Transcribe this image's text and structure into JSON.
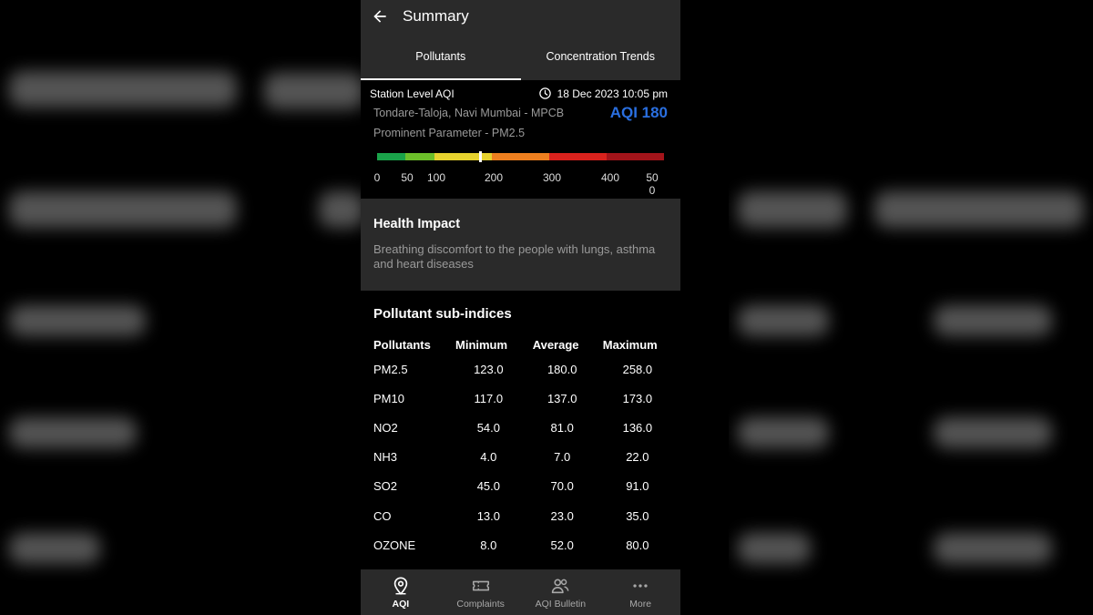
{
  "header": {
    "title": "Summary"
  },
  "tabs": [
    {
      "label": "Pollutants",
      "active": true
    },
    {
      "label": "Concentration Trends",
      "active": false
    }
  ],
  "station": {
    "heading": "Station Level AQI",
    "timestamp": "18 Dec 2023 10:05 pm",
    "location": "Tondare-Taloja, Navi Mumbai - MPCB",
    "aqi": "AQI 180",
    "aqi_value": 180,
    "prominent": "Prominent Parameter - PM2.5",
    "scale_ticks": [
      "0",
      "50",
      "100",
      "200",
      "300",
      "400",
      "500"
    ]
  },
  "health": {
    "title": "Health Impact",
    "text": "Breathing discomfort to the people with lungs, asthma and heart diseases"
  },
  "subindices": {
    "title": "Pollutant sub-indices",
    "columns": [
      "Pollutants",
      "Minimum",
      "Average",
      "Maximum"
    ],
    "rows": [
      [
        "PM2.5",
        "123.0",
        "180.0",
        "258.0"
      ],
      [
        "PM10",
        "117.0",
        "137.0",
        "173.0"
      ],
      [
        "NO2",
        "54.0",
        "81.0",
        "136.0"
      ],
      [
        "NH3",
        "4.0",
        "7.0",
        "22.0"
      ],
      [
        "SO2",
        "45.0",
        "70.0",
        "91.0"
      ],
      [
        "CO",
        "13.0",
        "23.0",
        "35.0"
      ],
      [
        "OZONE",
        "8.0",
        "52.0",
        "80.0"
      ]
    ]
  },
  "bottom_nav": [
    {
      "label": "AQI",
      "icon": "location-pin-icon",
      "active": true
    },
    {
      "label": "Complaints",
      "icon": "ticket-icon",
      "active": false
    },
    {
      "label": "AQI Bulletin",
      "icon": "users-icon",
      "active": false
    },
    {
      "label": "More",
      "icon": "more-dots-icon",
      "active": false
    }
  ],
  "colors": {
    "aqi_accent": "#2a6fe0",
    "good": "#1aa34a",
    "satisfactory": "#6cbf2a",
    "moderate": "#e6d22e",
    "poor": "#ee7f1f",
    "very_poor": "#d9221d",
    "severe": "#a3141a"
  }
}
